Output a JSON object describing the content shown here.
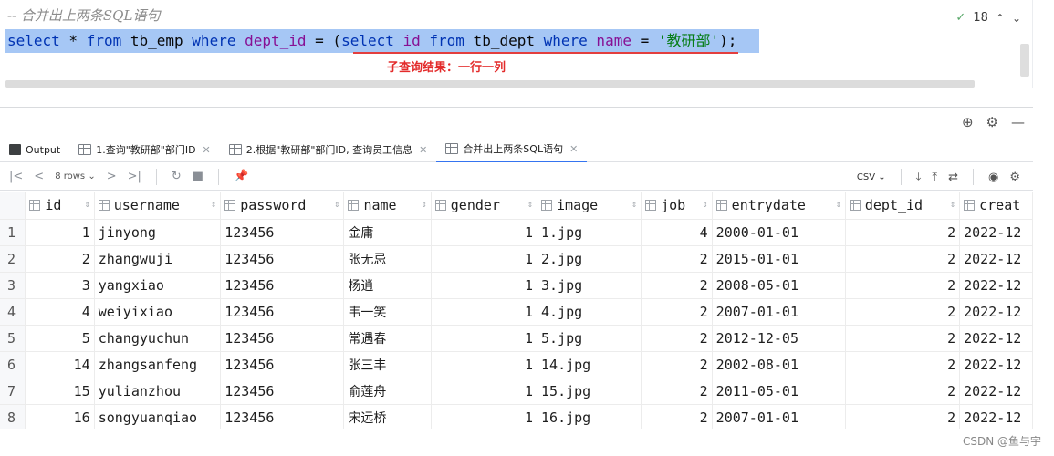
{
  "editor": {
    "comment": "-- 合并出上两条SQL语句",
    "sql": {
      "kw_select": "select",
      "star": " * ",
      "kw_from": "from",
      "table1": " tb_emp ",
      "kw_where": "where",
      "field1": " dept_id",
      "eq1": " = (",
      "kw_select2": "select",
      "field2": " id ",
      "kw_from2": "from",
      "table2": " tb_dept ",
      "kw_where2": "where",
      "field3": " name",
      "eq2": " = ",
      "string": "'教研部'",
      "end": ");"
    },
    "annotation": "子查询结果：一行一列",
    "inspection": {
      "check_icon": "check-icon",
      "count": "18"
    }
  },
  "tabs": [
    {
      "label": "Output",
      "active": false
    },
    {
      "label": "1.查询\"教研部\"部门ID",
      "active": false
    },
    {
      "label": "2.根据\"教研部\"部门ID, 查询员工信息",
      "active": false
    },
    {
      "label": "合并出上两条SQL语句",
      "active": true
    }
  ],
  "toolbar": {
    "rows_label": "8 rows",
    "export_format": "CSV"
  },
  "grid": {
    "columns": [
      "id",
      "username",
      "password",
      "name",
      "gender",
      "image",
      "job",
      "entrydate",
      "dept_id",
      "creat"
    ],
    "rows": [
      {
        "n": "1",
        "id": "1",
        "username": "jinyong",
        "password": "123456",
        "name": "金庸",
        "gender": "1",
        "image": "1.jpg",
        "job": "4",
        "entrydate": "2000-01-01",
        "dept_id": "2",
        "create": "2022-12"
      },
      {
        "n": "2",
        "id": "2",
        "username": "zhangwuji",
        "password": "123456",
        "name": "张无忌",
        "gender": "1",
        "image": "2.jpg",
        "job": "2",
        "entrydate": "2015-01-01",
        "dept_id": "2",
        "create": "2022-12"
      },
      {
        "n": "3",
        "id": "3",
        "username": "yangxiao",
        "password": "123456",
        "name": "杨逍",
        "gender": "1",
        "image": "3.jpg",
        "job": "2",
        "entrydate": "2008-05-01",
        "dept_id": "2",
        "create": "2022-12"
      },
      {
        "n": "4",
        "id": "4",
        "username": "weiyixiao",
        "password": "123456",
        "name": "韦一笑",
        "gender": "1",
        "image": "4.jpg",
        "job": "2",
        "entrydate": "2007-01-01",
        "dept_id": "2",
        "create": "2022-12"
      },
      {
        "n": "5",
        "id": "5",
        "username": "changyuchun",
        "password": "123456",
        "name": "常遇春",
        "gender": "1",
        "image": "5.jpg",
        "job": "2",
        "entrydate": "2012-12-05",
        "dept_id": "2",
        "create": "2022-12"
      },
      {
        "n": "6",
        "id": "14",
        "username": "zhangsanfeng",
        "password": "123456",
        "name": "张三丰",
        "gender": "1",
        "image": "14.jpg",
        "job": "2",
        "entrydate": "2002-08-01",
        "dept_id": "2",
        "create": "2022-12"
      },
      {
        "n": "7",
        "id": "15",
        "username": "yulianzhou",
        "password": "123456",
        "name": "俞莲舟",
        "gender": "1",
        "image": "15.jpg",
        "job": "2",
        "entrydate": "2011-05-01",
        "dept_id": "2",
        "create": "2022-12"
      },
      {
        "n": "8",
        "id": "16",
        "username": "songyuanqiao",
        "password": "123456",
        "name": "宋远桥",
        "gender": "1",
        "image": "16.jpg",
        "job": "2",
        "entrydate": "2007-01-01",
        "dept_id": "2",
        "create": "2022-12"
      }
    ]
  },
  "watermark": "CSDN @鱼与宇",
  "colors": {
    "selection": "#a6c7f5",
    "keyword": "#0033b3",
    "string": "#067d17",
    "annotation": "#e32b2b",
    "active_tab": "#3574f0"
  }
}
